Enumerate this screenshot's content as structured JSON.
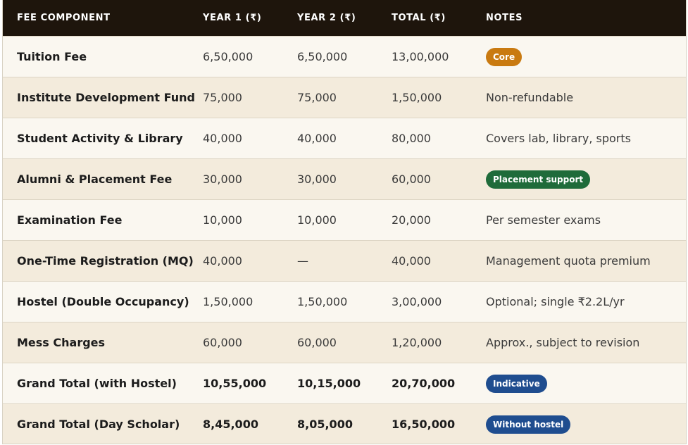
{
  "columns": [
    "FEE COMPONENT",
    "YEAR 1 (₹)",
    "YEAR 2 (₹)",
    "TOTAL (₹)",
    "NOTES"
  ],
  "rows": [
    {
      "component": "Tuition Fee",
      "year1": "6,50,000",
      "year2": "6,50,000",
      "total": "13,00,000",
      "note": "Core",
      "note_type": "badge",
      "badge_color": "#c97a10"
    },
    {
      "component": "Institute Development Fund",
      "year1": "75,000",
      "year2": "75,000",
      "total": "1,50,000",
      "note": "Non-refundable",
      "note_type": "text"
    },
    {
      "component": "Student Activity & Library",
      "year1": "40,000",
      "year2": "40,000",
      "total": "80,000",
      "note": "Covers lab, library, sports",
      "note_type": "text"
    },
    {
      "component": "Alumni & Placement Fee",
      "year1": "30,000",
      "year2": "30,000",
      "total": "60,000",
      "note": "Placement support",
      "note_type": "badge",
      "badge_color": "#1f6b3a"
    },
    {
      "component": "Examination Fee",
      "year1": "10,000",
      "year2": "10,000",
      "total": "20,000",
      "note": "Per semester exams",
      "note_type": "text"
    },
    {
      "component": "One-Time Registration (MQ)",
      "year1": "40,000",
      "year2": "—",
      "total": "40,000",
      "note": "Management quota premium",
      "note_type": "text"
    },
    {
      "component": "Hostel (Double Occupancy)",
      "year1": "1,50,000",
      "year2": "1,50,000",
      "total": "3,00,000",
      "note": "Optional; single ₹2.2L/yr",
      "note_type": "text"
    },
    {
      "component": "Mess Charges",
      "year1": "60,000",
      "year2": "60,000",
      "total": "1,20,000",
      "note": "Approx., subject to revision",
      "note_type": "text"
    },
    {
      "component": "Grand Total (with Hostel)",
      "year1": "10,55,000",
      "year2": "10,15,000",
      "total": "20,70,000",
      "note": "Indicative",
      "note_type": "badge",
      "badge_color": "#1f4d8f",
      "bold": true
    },
    {
      "component": "Grand Total (Day Scholar)",
      "year1": "8,45,000",
      "year2": "8,05,000",
      "total": "16,50,000",
      "note": "Without hostel",
      "note_type": "badge",
      "badge_color": "#1f4d8f",
      "bold": true
    }
  ]
}
